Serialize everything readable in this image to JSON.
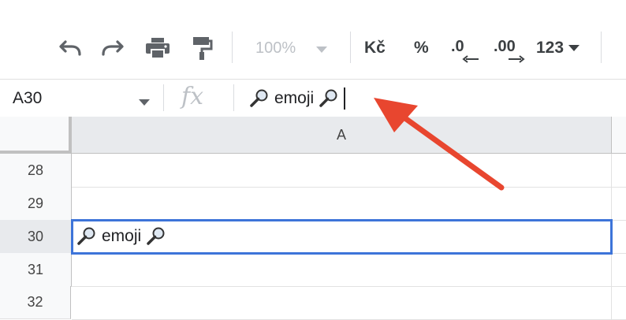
{
  "toolbar": {
    "undo_icon": "undo-icon",
    "redo_icon": "redo-icon",
    "print_icon": "print-icon",
    "paint_format_icon": "paint-format-icon",
    "zoom_value": "100%",
    "currency_label": "Kč",
    "percent_label": "%",
    "decrease_decimal_label": ".0",
    "increase_decimal_label": ".00",
    "more_formats_label": "123"
  },
  "formula_bar": {
    "cell_reference": "A30",
    "fx_label": "fx",
    "value": "emoji",
    "emoji_icon": "magnifying-glass-icon"
  },
  "grid": {
    "column_header": "A",
    "rows": [
      {
        "number": "28",
        "value": ""
      },
      {
        "number": "29",
        "value": ""
      },
      {
        "number": "30",
        "value": "emoji",
        "selected": true
      },
      {
        "number": "31",
        "value": ""
      },
      {
        "number": "32",
        "value": ""
      }
    ]
  },
  "colors": {
    "selection": "#3d74d9",
    "annotation_arrow": "#e8462f"
  }
}
